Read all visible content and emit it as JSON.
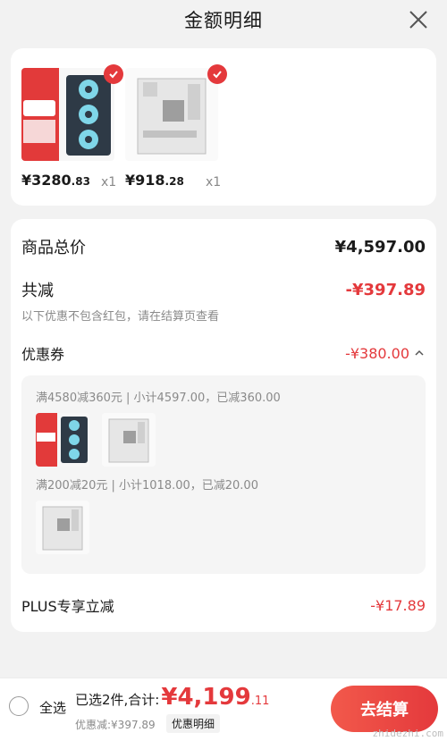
{
  "header": {
    "title": "金额明细"
  },
  "products": [
    {
      "price_int": "¥3280",
      "price_dec": ".83",
      "qty": "x1",
      "thumb": "gpu"
    },
    {
      "price_int": "¥918",
      "price_dec": ".28",
      "qty": "x1",
      "thumb": "motherboard"
    }
  ],
  "summary": {
    "total_label": "商品总价",
    "total_value": "¥4,597.00",
    "discount_label": "共减",
    "discount_value": "-¥397.89",
    "discount_note": "以下优惠不包含红包，请在结算页查看",
    "coupon_label": "优惠券",
    "coupon_value": "-¥380.00",
    "coupon_lines": [
      "满4580减360元 | 小计4597.00，已减360.00",
      "满200减20元 | 小计1018.00，已减20.00"
    ],
    "plus_label": "PLUS专享立减",
    "plus_value": "-¥17.89"
  },
  "bottom": {
    "select_all": "全选",
    "selected_info": "已选2件,合计:",
    "total_int": "¥4,199",
    "total_dec": ".11",
    "savings": "优惠减:¥397.89",
    "detail_button": "优惠明细",
    "submit_button": "去结算"
  },
  "watermark": "zhidezhi.com",
  "colors": {
    "accent": "#e4393c",
    "background": "#f2f2f2"
  }
}
